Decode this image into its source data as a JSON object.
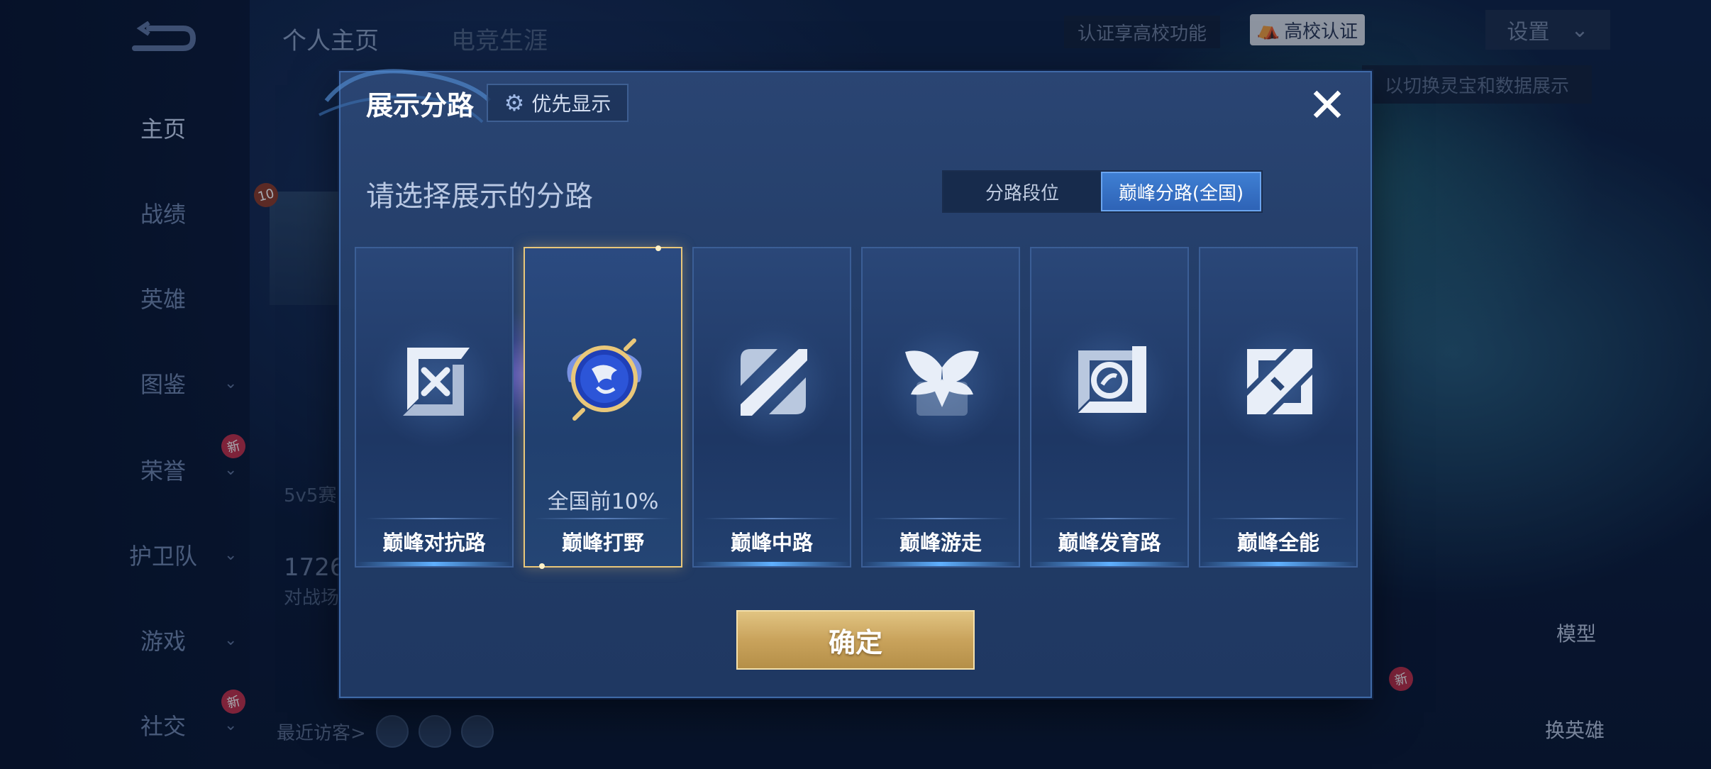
{
  "background": {
    "nav": [
      {
        "label": "主页",
        "active": true
      },
      {
        "label": "战绩"
      },
      {
        "label": "英雄"
      },
      {
        "label": "图鉴",
        "chevron": true
      },
      {
        "label": "荣誉",
        "chevron": true,
        "badge": "新"
      },
      {
        "label": "护卫队",
        "chevron": true
      },
      {
        "label": "游戏",
        "chevron": true
      },
      {
        "label": "社交",
        "chevron": true,
        "badge": "新"
      }
    ],
    "top_tabs": [
      "个人主页",
      "电竞生涯"
    ],
    "cert_text": "认证享高校功能",
    "cert_badge": "高校认证",
    "settings_label": "设置",
    "hint_text": "以切换灵宝和数据展示",
    "level_badge": "10",
    "stat_mode": "5v5赛",
    "stat_value": "1726",
    "stat_label": "对战场",
    "visitors_label": "最近访客>",
    "model_label": "模型",
    "swap_hero_label": "换英雄",
    "swap_badge": "新"
  },
  "dialog": {
    "title": "展示分路",
    "priority_button": "优先显示",
    "close_icon": "close-icon",
    "subtitle": "请选择展示的分路",
    "segments": [
      {
        "label": "分路段位",
        "selected": false
      },
      {
        "label": "巅峰分路(全国)",
        "selected": true
      }
    ],
    "cards": [
      {
        "name": "巅峰对抗路",
        "icon": "clash-lane-icon",
        "selected": false,
        "rank": ""
      },
      {
        "name": "巅峰打野",
        "icon": "jungle-dragon-icon",
        "selected": true,
        "rank": "全国前10%"
      },
      {
        "name": "巅峰中路",
        "icon": "mid-lane-icon",
        "selected": false,
        "rank": ""
      },
      {
        "name": "巅峰游走",
        "icon": "roam-wings-icon",
        "selected": false,
        "rank": ""
      },
      {
        "name": "巅峰发育路",
        "icon": "farm-lane-icon",
        "selected": false,
        "rank": ""
      },
      {
        "name": "巅峰全能",
        "icon": "all-round-icon",
        "selected": false,
        "rank": ""
      }
    ],
    "confirm_button": "确定"
  },
  "colors": {
    "accent_gold": "#e9c77a",
    "segment_active": "#3f7fd3",
    "dialog_bg": "#233d68"
  }
}
